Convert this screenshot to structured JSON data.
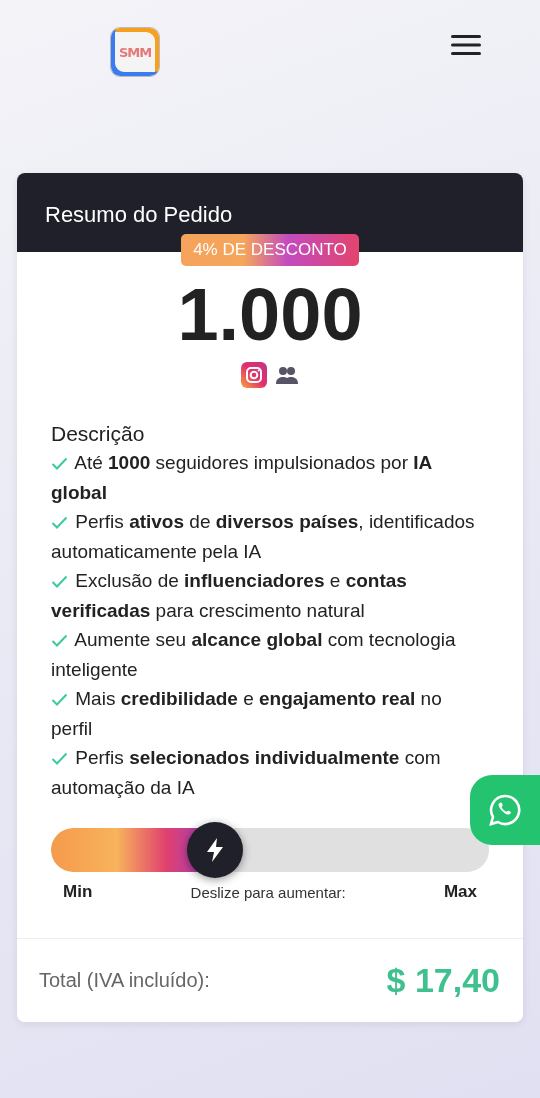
{
  "header": {
    "logo_text": "SMM"
  },
  "order": {
    "title": "Resumo do Pedido",
    "discount_badge": "4% DE DESCONTO",
    "quantity": "1.000",
    "description_title": "Descrição",
    "features": [
      "Até **1000** seguidores impulsionados por **IA global**",
      "Perfis **ativos** de **diversos países**, identificados automaticamente pela IA",
      "Exclusão de **influenciadores** e **contas verificadas** para crescimento natural",
      "Aumente seu **alcance global** com tecnologia inteligente",
      "Mais **credibilidade** e **engajamento real** no perfil",
      "Perfis **selecionados individualmente** com automação da IA"
    ],
    "slider": {
      "level": 0.375,
      "min_label": "Min",
      "hint": "Deslize para aumentar:",
      "max_label": "Max"
    },
    "total_label": "Total (IVA incluído):",
    "total_value": "$ 17,40"
  }
}
